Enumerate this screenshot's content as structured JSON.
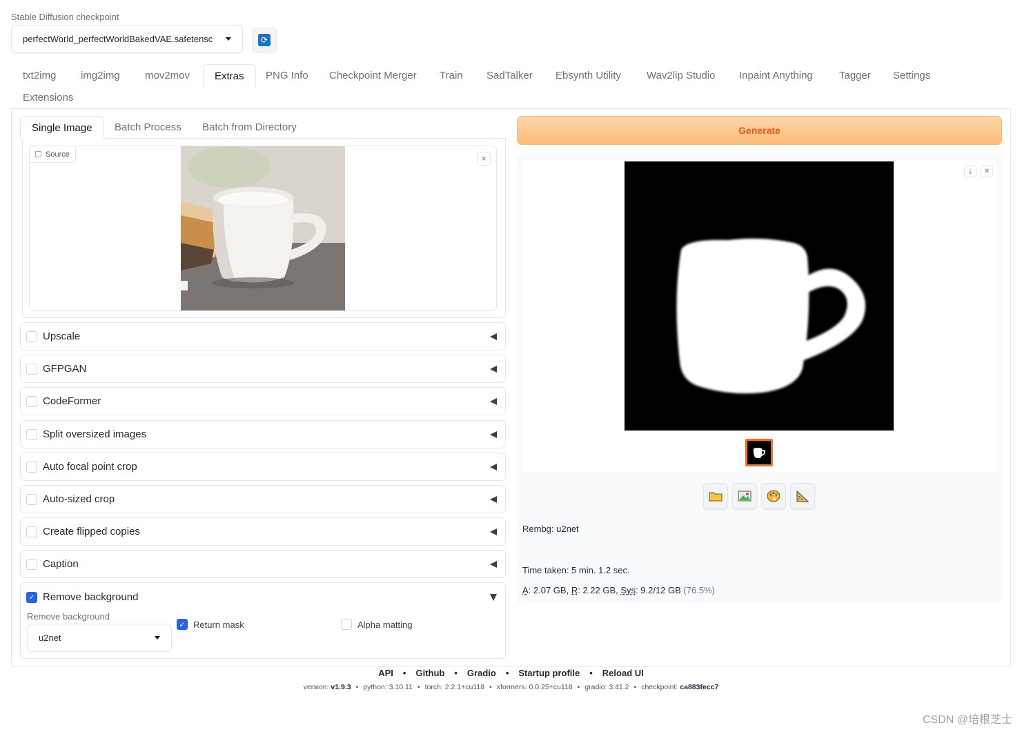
{
  "checkpoint": {
    "label": "Stable Diffusion checkpoint",
    "value": "perfectWorld_perfectWorldBakedVAE.safetensc"
  },
  "tabs": [
    "txt2img",
    "img2img",
    "mov2mov",
    "Extras",
    "PNG Info",
    "Checkpoint Merger",
    "Train",
    "SadTalker",
    "Ebsynth Utility",
    "Wav2lip Studio",
    "Inpaint Anything",
    "Tagger",
    "Settings",
    "Extensions"
  ],
  "active_tab": "Extras",
  "subtabs": [
    "Single Image",
    "Batch Process",
    "Batch from Directory"
  ],
  "active_subtab": "Single Image",
  "source": {
    "label": "Source",
    "close": "×"
  },
  "accordions": [
    {
      "label": "Upscale",
      "checked": false
    },
    {
      "label": "GFPGAN",
      "checked": false
    },
    {
      "label": "CodeFormer",
      "checked": false
    },
    {
      "label": "Split oversized images",
      "checked": false
    },
    {
      "label": "Auto focal point crop",
      "checked": false
    },
    {
      "label": "Auto-sized crop",
      "checked": false
    },
    {
      "label": "Create flipped copies",
      "checked": false
    },
    {
      "label": "Caption",
      "checked": false
    }
  ],
  "remove_background": {
    "label": "Remove background",
    "checked": true,
    "model_label": "Remove background",
    "model_value": "u2net",
    "return_mask_label": "Return mask",
    "return_mask_checked": true,
    "alpha_matting_label": "Alpha matting",
    "alpha_matting_checked": false
  },
  "generate_label": "Generate",
  "output": {
    "rembg": "Rembg: u2net",
    "time_taken": "Time taken: 5 min. 1.2 sec.",
    "mem_a_label": "A",
    "mem_a": ": 2.07 GB, ",
    "mem_r_label": "R",
    "mem_r": ": 2.22 GB, ",
    "mem_sys_label": "Sys",
    "mem_sys": ": 9.2/12 GB ",
    "mem_pct": "(76.5%)"
  },
  "footer": {
    "links": [
      "API",
      "Github",
      "Gradio",
      "Startup profile",
      "Reload UI"
    ],
    "version_label": "version: ",
    "version": "v1.9.3",
    "python_label": "python: ",
    "python": "3.10.11",
    "torch_label": "torch: ",
    "torch": "2.2.1+cu118",
    "xformers_label": "xformers: ",
    "xformers": "0.0.25+cu118",
    "gradio_label": "gradio: ",
    "gradio": "3.41.2",
    "checkpoint_label": "checkpoint: ",
    "checkpoint": "ca883fecc7"
  },
  "watermark": "CSDN @培根芝士",
  "colors": {
    "accent": "#ea580c",
    "checkbox": "#2563eb",
    "generate_bg": "#fdba74"
  }
}
